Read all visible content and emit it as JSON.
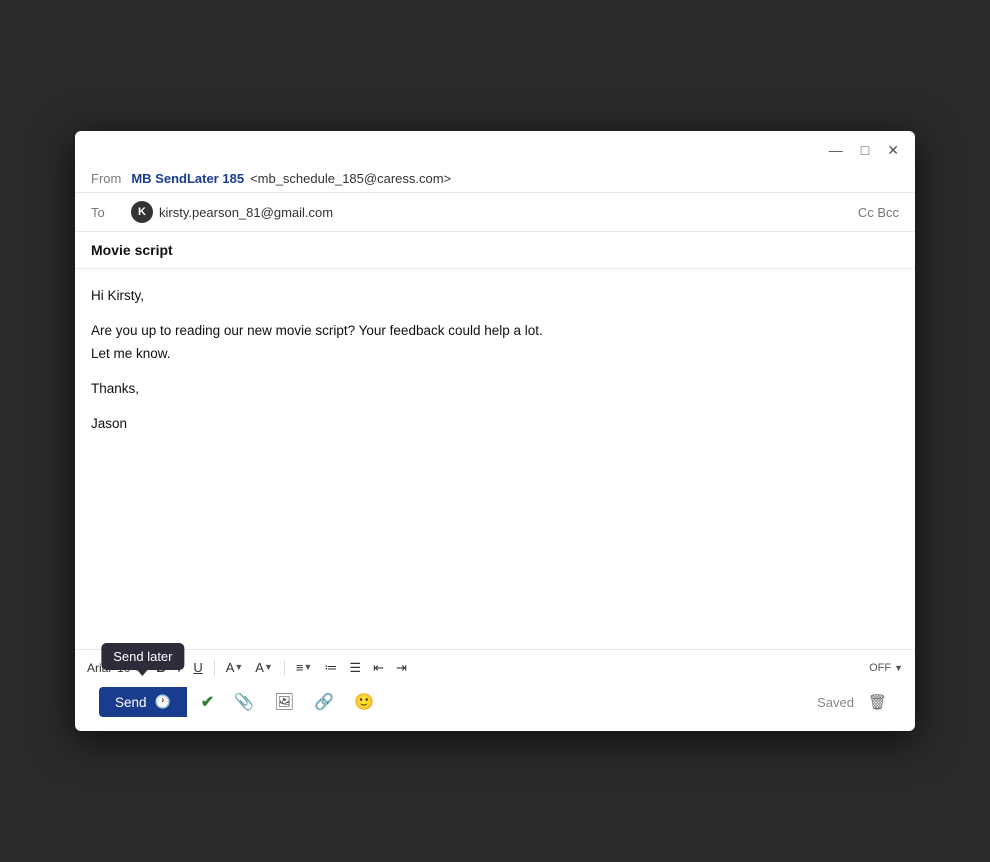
{
  "window": {
    "controls": {
      "minimize": "—",
      "maximize": "□",
      "close": "✕"
    }
  },
  "from": {
    "label": "From",
    "sender_name": "MB SendLater 185",
    "sender_email": "<mb_schedule_185@caress.com>"
  },
  "to": {
    "label": "To",
    "recipient_avatar": "K",
    "recipient_email": "kirsty.pearson_81@gmail.com",
    "cc_bcc": "Cc Bcc"
  },
  "subject": {
    "text": "Movie script"
  },
  "body": {
    "greeting": "Hi Kirsty,",
    "paragraph1": "Are you up to reading our new movie script? Your feedback could help a lot.",
    "paragraph2": "Let me know.",
    "closing": "Thanks,",
    "signature": "Jason"
  },
  "toolbar": {
    "font_name": "Arial",
    "font_size": "10",
    "bold": "B",
    "italic": "I",
    "underline": "U",
    "off_label": "OFF"
  },
  "actions": {
    "send": "Send",
    "send_later_tooltip": "Send later",
    "saved": "Saved"
  }
}
